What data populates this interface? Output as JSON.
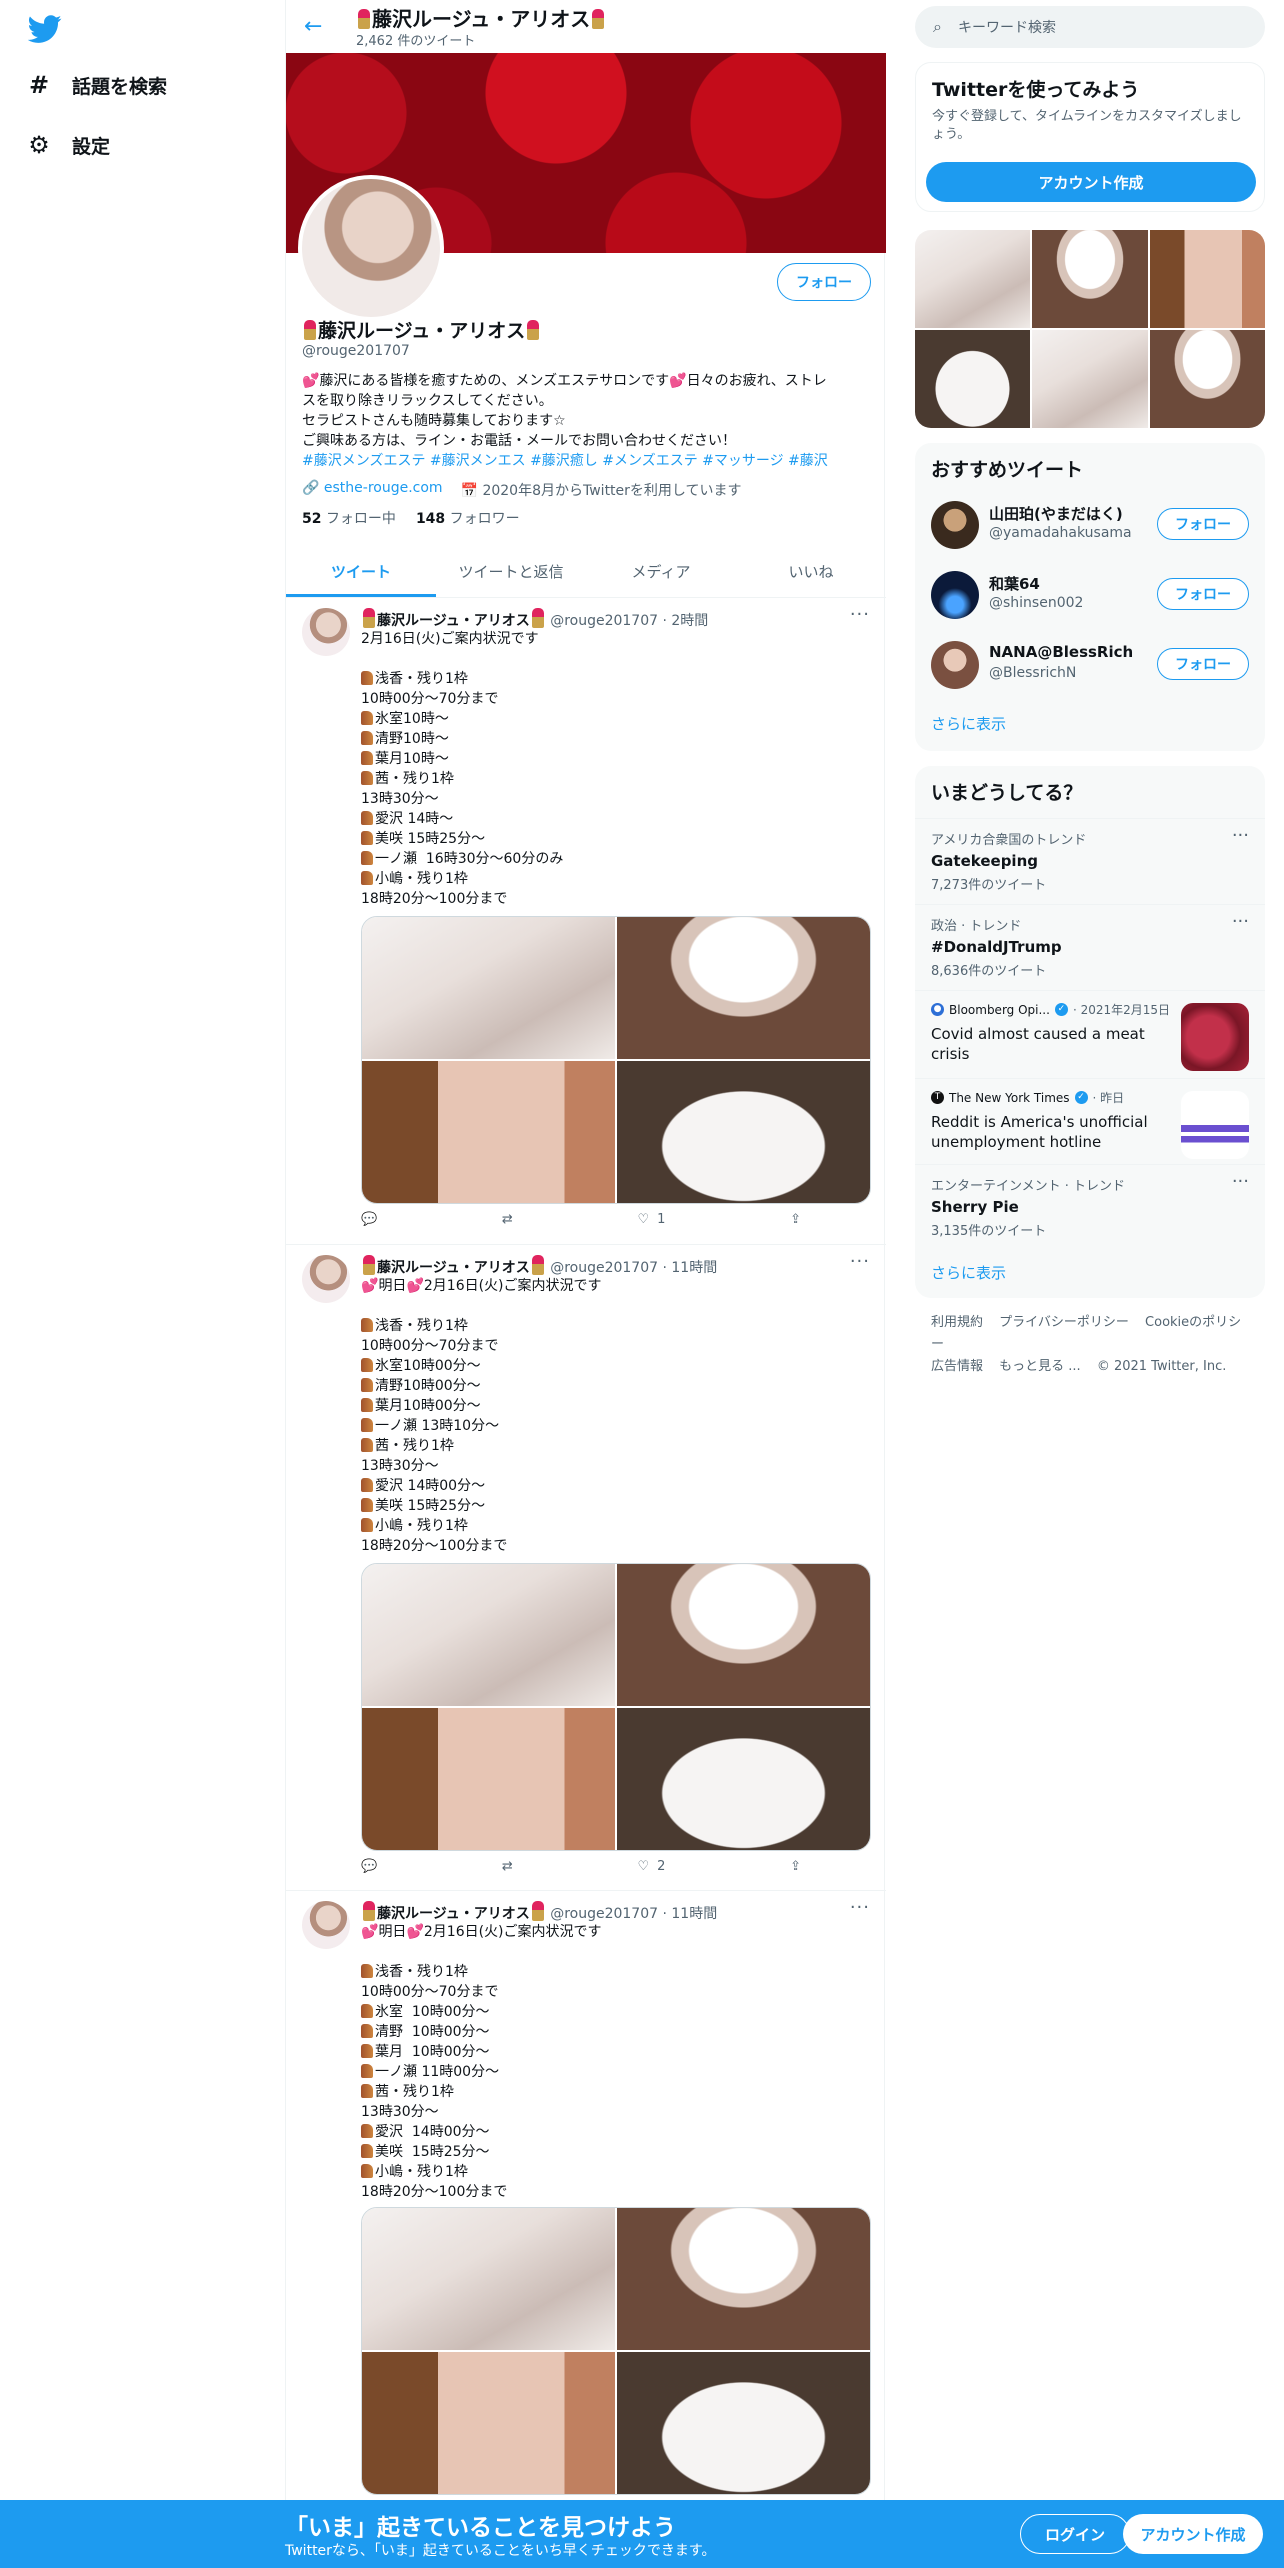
{
  "nav": {
    "explore": "話題を検索",
    "settings": "設定"
  },
  "header": {
    "title": "藤沢ルージュ・アリオス",
    "tweet_count": "2,462 件のツイート"
  },
  "profile": {
    "follow_label": "フォロー",
    "name": "藤沢ルージュ・アリオス",
    "handle": "@rouge201707",
    "bio": [
      "藤沢にある皆様を癒すための、メンズエステサロンです",
      "日々のお疲れ、ストレ",
      "スを取り除きリラックスしてください。",
      "セラピストさんも随時募集しております☆",
      "ご興味ある方は、ライン・お電話・メールでお問い合わせください！"
    ],
    "hashtags": "#藤沢メンズエステ #藤沢メンエス #藤沢癒し  #メンズエステ #マッサージ #藤沢",
    "website": "esthe-rouge.com",
    "joined": "2020年8月からTwitterを利用しています",
    "following_count": "52",
    "following_label": "フォロー中",
    "followers_count": "148",
    "followers_label": "フォロワー"
  },
  "tabs": [
    "ツイート",
    "ツイートと返信",
    "メディア",
    "いいね"
  ],
  "tweets": [
    {
      "name": "藤沢ルージュ・アリオス",
      "meta": "@rouge201707 · 2時間",
      "first_line": "2月16日(火)ご案内状況です",
      "lines": [
        "浅香・残り1枠",
        "10時00分～70分まで",
        "氷室10時～",
        "清野10時～",
        "葉月10時～",
        "茜・残り1枠",
        "13時30分～",
        "愛沢 14時～",
        "美咲 15時25分～",
        "一ノ瀬  16時30分～60分のみ",
        "小嶋・残り1枠",
        "18時20分～100分まで"
      ],
      "likes": "1"
    },
    {
      "name": "藤沢ルージュ・アリオス",
      "meta": "@rouge201707 · 11時間",
      "first_line": "明日",
      "first_line_rest": "2月16日(火)ご案内状況です",
      "lines": [
        "浅香・残り1枠",
        "10時00分～70分まで",
        "氷室10時00分～",
        "清野10時00分～",
        "葉月10時00分～",
        "一ノ瀬 13時10分～",
        "茜・残り1枠",
        "13時30分～",
        "愛沢 14時00分～",
        "美咲 15時25分～",
        "小嶋・残り1枠",
        "18時20分～100分まで"
      ],
      "likes": "2"
    },
    {
      "name": "藤沢ルージュ・アリオス",
      "meta": "@rouge201707 · 11時間",
      "first_line": "明日",
      "first_line_rest": "2月16日(火)ご案内状況です",
      "lines": [
        "浅香・残り1枠",
        "10時00分～70分まで",
        "氷室  10時00分～",
        "清野  10時00分～",
        "葉月  10時00分～",
        "一ノ瀬 11時00分～",
        "茜・残り1枠",
        "13時30分～",
        "愛沢  14時00分～",
        "美咲  15時25分～",
        "小嶋・残り1枠",
        "18時20分～100分まで"
      ],
      "likes": ""
    }
  ],
  "sidebar": {
    "search_placeholder": "キーワード検索",
    "join_title": "Twitterを使ってみよう",
    "join_desc": "今すぐ登録して、タイムラインをカスタマイズしましょう。",
    "join_button": "アカウント作成",
    "rec_title": "おすすめツイート",
    "rec_users": [
      {
        "name": "山田珀(やまだはく)",
        "handle": "@yamadahakusama"
      },
      {
        "name": "和葉64",
        "handle": "@shinsen002"
      },
      {
        "name": "NANA@BlessRich",
        "handle": "@BlessrichN"
      }
    ],
    "follow_label": "フォロー",
    "show_more": "さらに表示",
    "trends_title": "いまどうしてる？",
    "trends": [
      {
        "cat": "アメリカ合衆国のトレンド",
        "title": "Gatekeeping",
        "count": "7,273件のツイート"
      },
      {
        "cat": "政治 · トレンド",
        "title": "#DonaldJTrump",
        "count": "8,636件のツイート"
      }
    ],
    "news": [
      {
        "source": "Bloomberg Opi...",
        "time": "· 2021年2月15日",
        "headline": "Covid almost caused a meat crisis"
      },
      {
        "source": "The New York Times",
        "time": "· 昨日",
        "headline": "Reddit is America's unofficial unemployment hotline"
      }
    ],
    "trend3": {
      "cat": "エンターテインメント · トレンド",
      "title": "Sherry Pie",
      "count": "3,135件のツイート"
    },
    "footer": [
      "利用規約",
      "プライバシーポリシー",
      "Cookieのポリシー",
      "広告情報",
      "もっと見る ...",
      "© 2021 Twitter, Inc."
    ]
  },
  "bottom": {
    "headline": "「いま」起きていることを見つけよう",
    "sub": "Twitterなら、「いま」起きていることをいち早くチェックできます。",
    "login": "ログイン",
    "signup": "アカウント作成"
  },
  "colors": {
    "accent": "#1d9bf0",
    "heart": "#e0245e"
  }
}
